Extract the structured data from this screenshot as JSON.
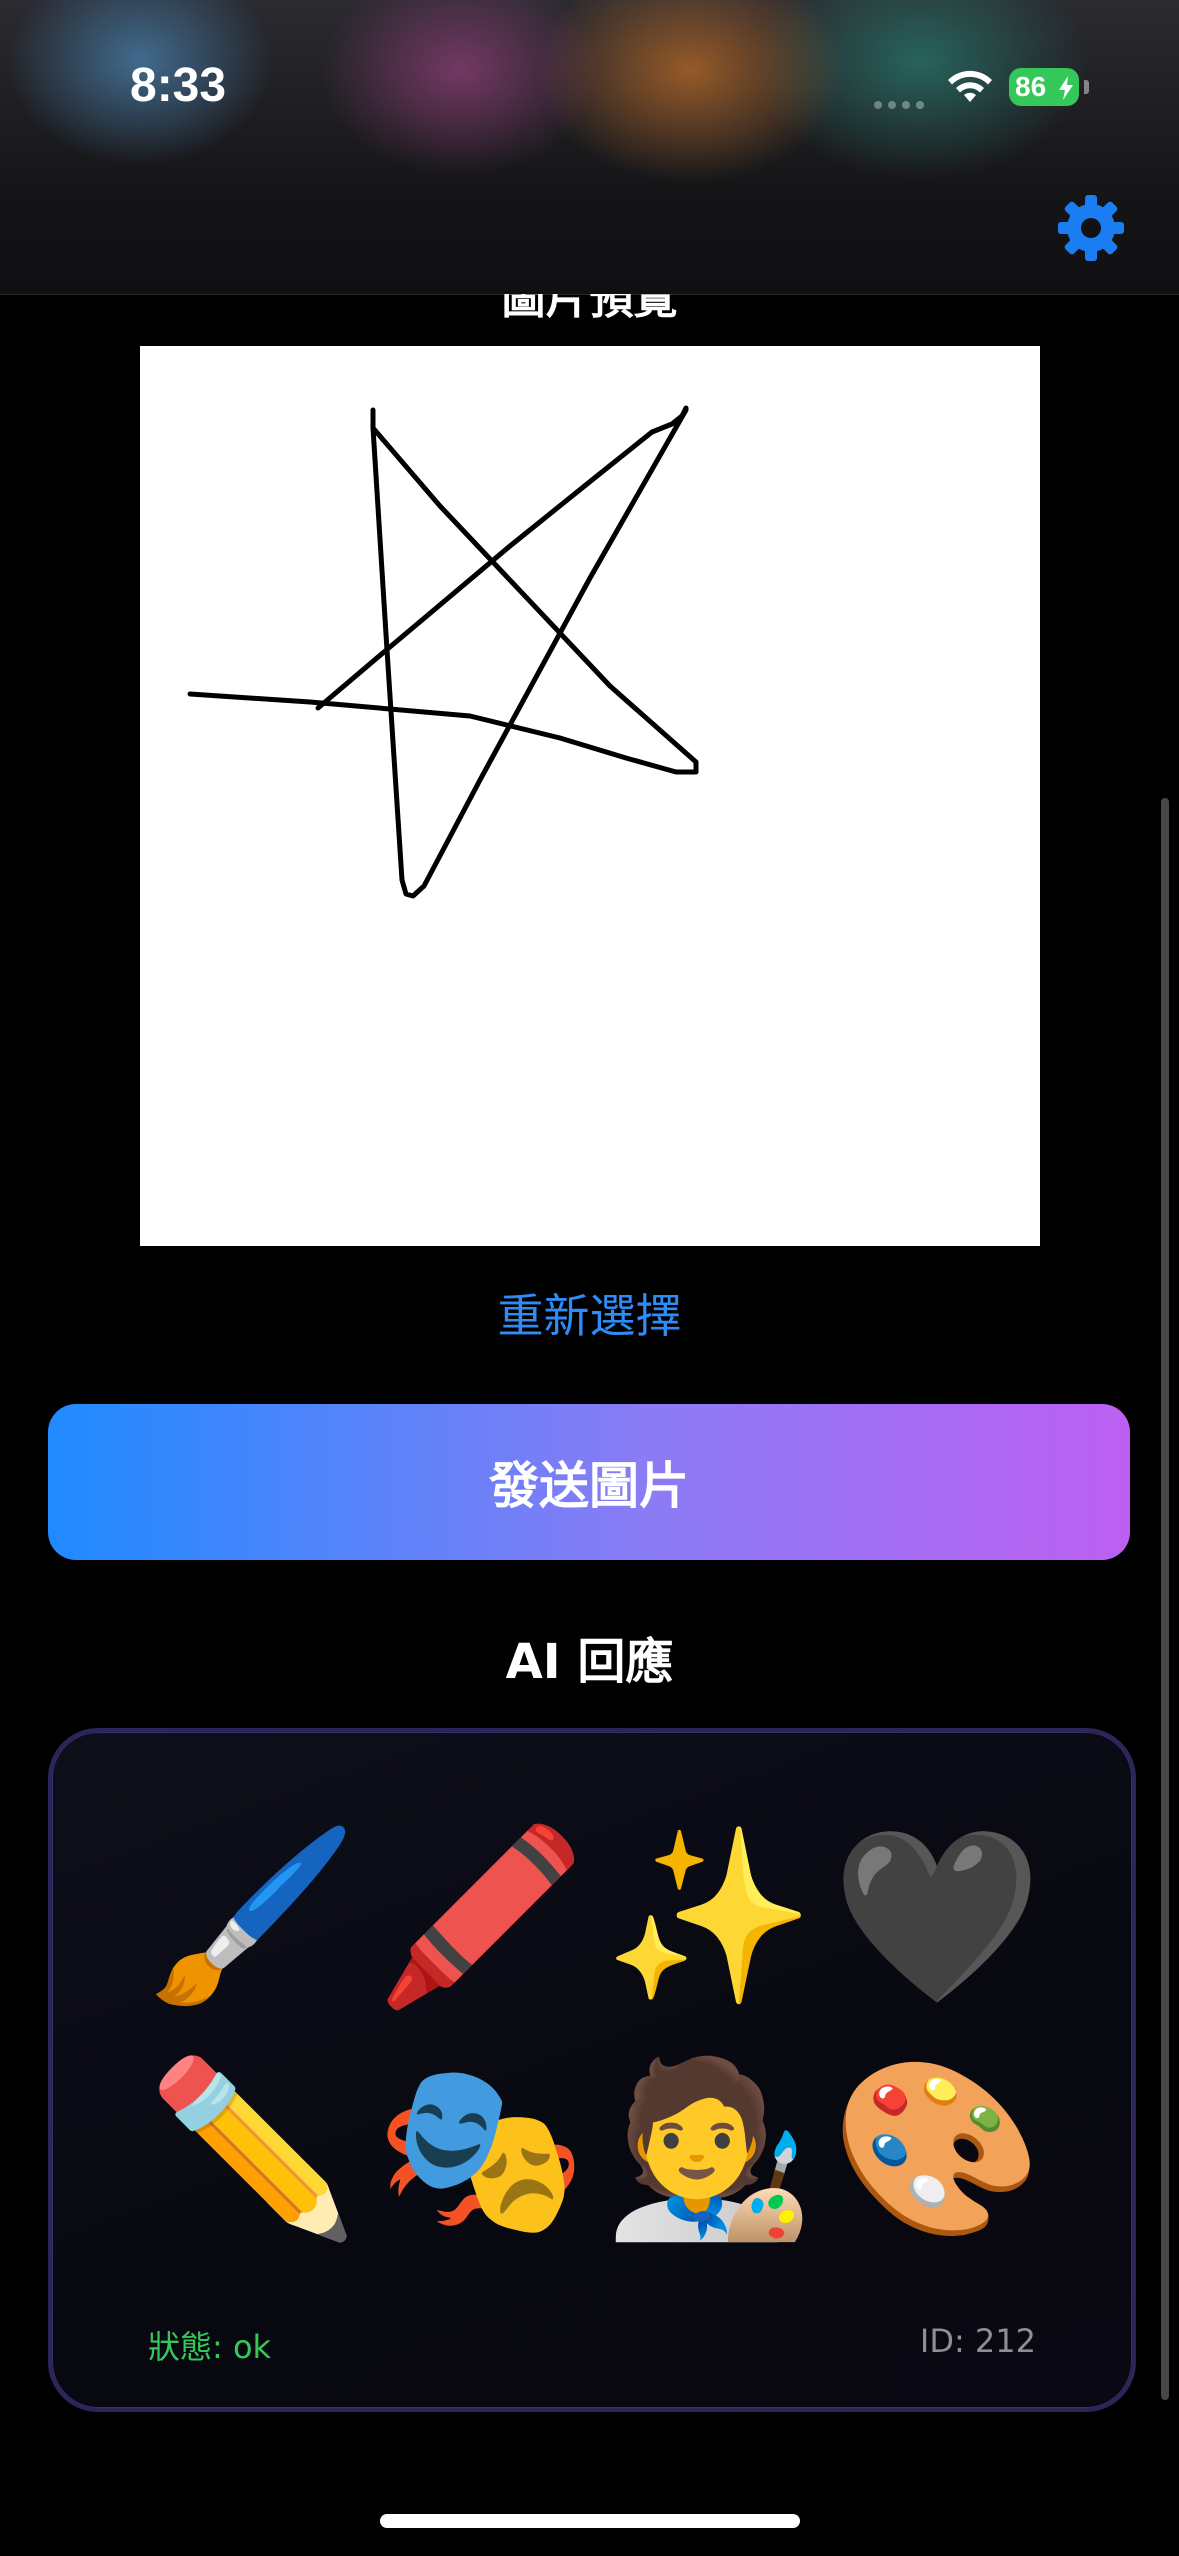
{
  "status_bar": {
    "time": "8:33",
    "battery": "86"
  },
  "header": {
    "settings_icon": "gear-icon"
  },
  "preview": {
    "title": "圖片預覽"
  },
  "actions": {
    "reselect_label": "重新選擇",
    "send_label": "發送圖片"
  },
  "ai_response": {
    "title": "AI 回應",
    "emojis": [
      "🖌️",
      "🖍️",
      "✨",
      "🖤",
      "✏️",
      "🎭",
      "🧑‍🎨",
      "🎨"
    ],
    "status": "狀態: ok",
    "id": "ID: 212"
  },
  "colors": {
    "accent": "#2f8cf7",
    "gradient_start": "#1f8bff",
    "gradient_end": "#bd60f2",
    "status_ok": "#34c759"
  }
}
